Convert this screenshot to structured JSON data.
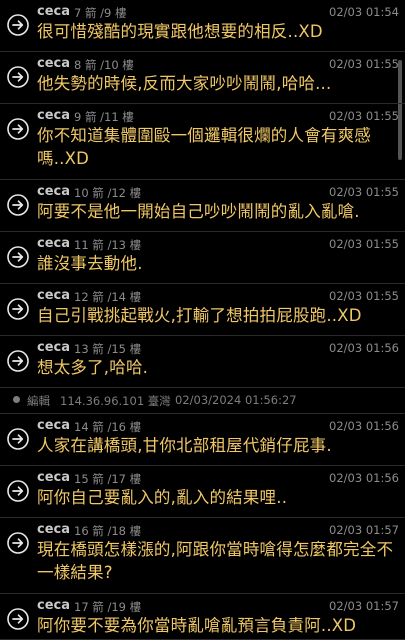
{
  "colors": {
    "background": "#000000",
    "push_text": "#f0c866",
    "meta_text": "#8c8c8c",
    "user_text": "#c9c9c9"
  },
  "replies": [
    {
      "user": "ceca",
      "floor": "7 箭 /9 樓",
      "time": "02/03 01:54",
      "text": "很可惜殘酷的現實跟他想要的相反..XD",
      "icon": "reply-arrow-icon"
    },
    {
      "user": "ceca",
      "floor": "8 箭 /10 樓",
      "time": "02/03 01:55",
      "text": "他失勢的時候,反而大家吵吵鬧鬧,哈哈...",
      "icon": "reply-arrow-icon"
    },
    {
      "user": "ceca",
      "floor": "9 箭 /11 樓",
      "time": "02/03 01:55",
      "text": "你不知道集體圍毆一個邏輯很爛的人會有爽感嗎..XD",
      "icon": "reply-arrow-icon"
    },
    {
      "user": "ceca",
      "floor": "10 箭 /12 樓",
      "time": "02/03 01:55",
      "text": "阿要不是他一開始自己吵吵鬧鬧的亂入亂嗆.",
      "icon": "reply-arrow-icon"
    },
    {
      "user": "ceca",
      "floor": "11 箭 /13 樓",
      "time": "02/03 01:55",
      "text": "誰沒事去動他.",
      "icon": "reply-arrow-icon"
    },
    {
      "user": "ceca",
      "floor": "12 箭 /14 樓",
      "time": "02/03 01:55",
      "text": "自己引戰挑起戰火,打輸了想拍拍屁股跑..XD",
      "icon": "reply-arrow-icon"
    },
    {
      "user": "ceca",
      "floor": "13 箭 /15 樓",
      "time": "02/03 01:56",
      "text": "想太多了,哈哈.",
      "icon": "reply-arrow-icon"
    },
    {
      "user": "ceca",
      "floor": "14 箭 /16 樓",
      "time": "02/03 01:56",
      "text": "人家在講橋頭,甘你北部租屋代銷仔屁事.",
      "icon": "reply-arrow-icon"
    },
    {
      "user": "ceca",
      "floor": "15 箭 /17 樓",
      "time": "02/03 01:56",
      "text": "阿你自己要亂入的,亂入的結果哩..",
      "icon": "reply-arrow-icon"
    },
    {
      "user": "ceca",
      "floor": "16 箭 /18 樓",
      "time": "02/03 01:57",
      "text": "現在橋頭怎樣漲的,阿跟你當時嗆得怎麼都完全不一樣結果?",
      "icon": "reply-arrow-icon"
    },
    {
      "user": "ceca",
      "floor": "17 箭 /19 樓",
      "time": "02/03 01:57",
      "text": "阿你要不要為你當時亂嗆亂預言負責阿..XD",
      "icon": "reply-arrow-icon"
    }
  ],
  "edit_note": {
    "label": "編輯",
    "ip": "114.36.96.101 臺灣",
    "timestamp": "02/03/2024 01:56:27"
  }
}
